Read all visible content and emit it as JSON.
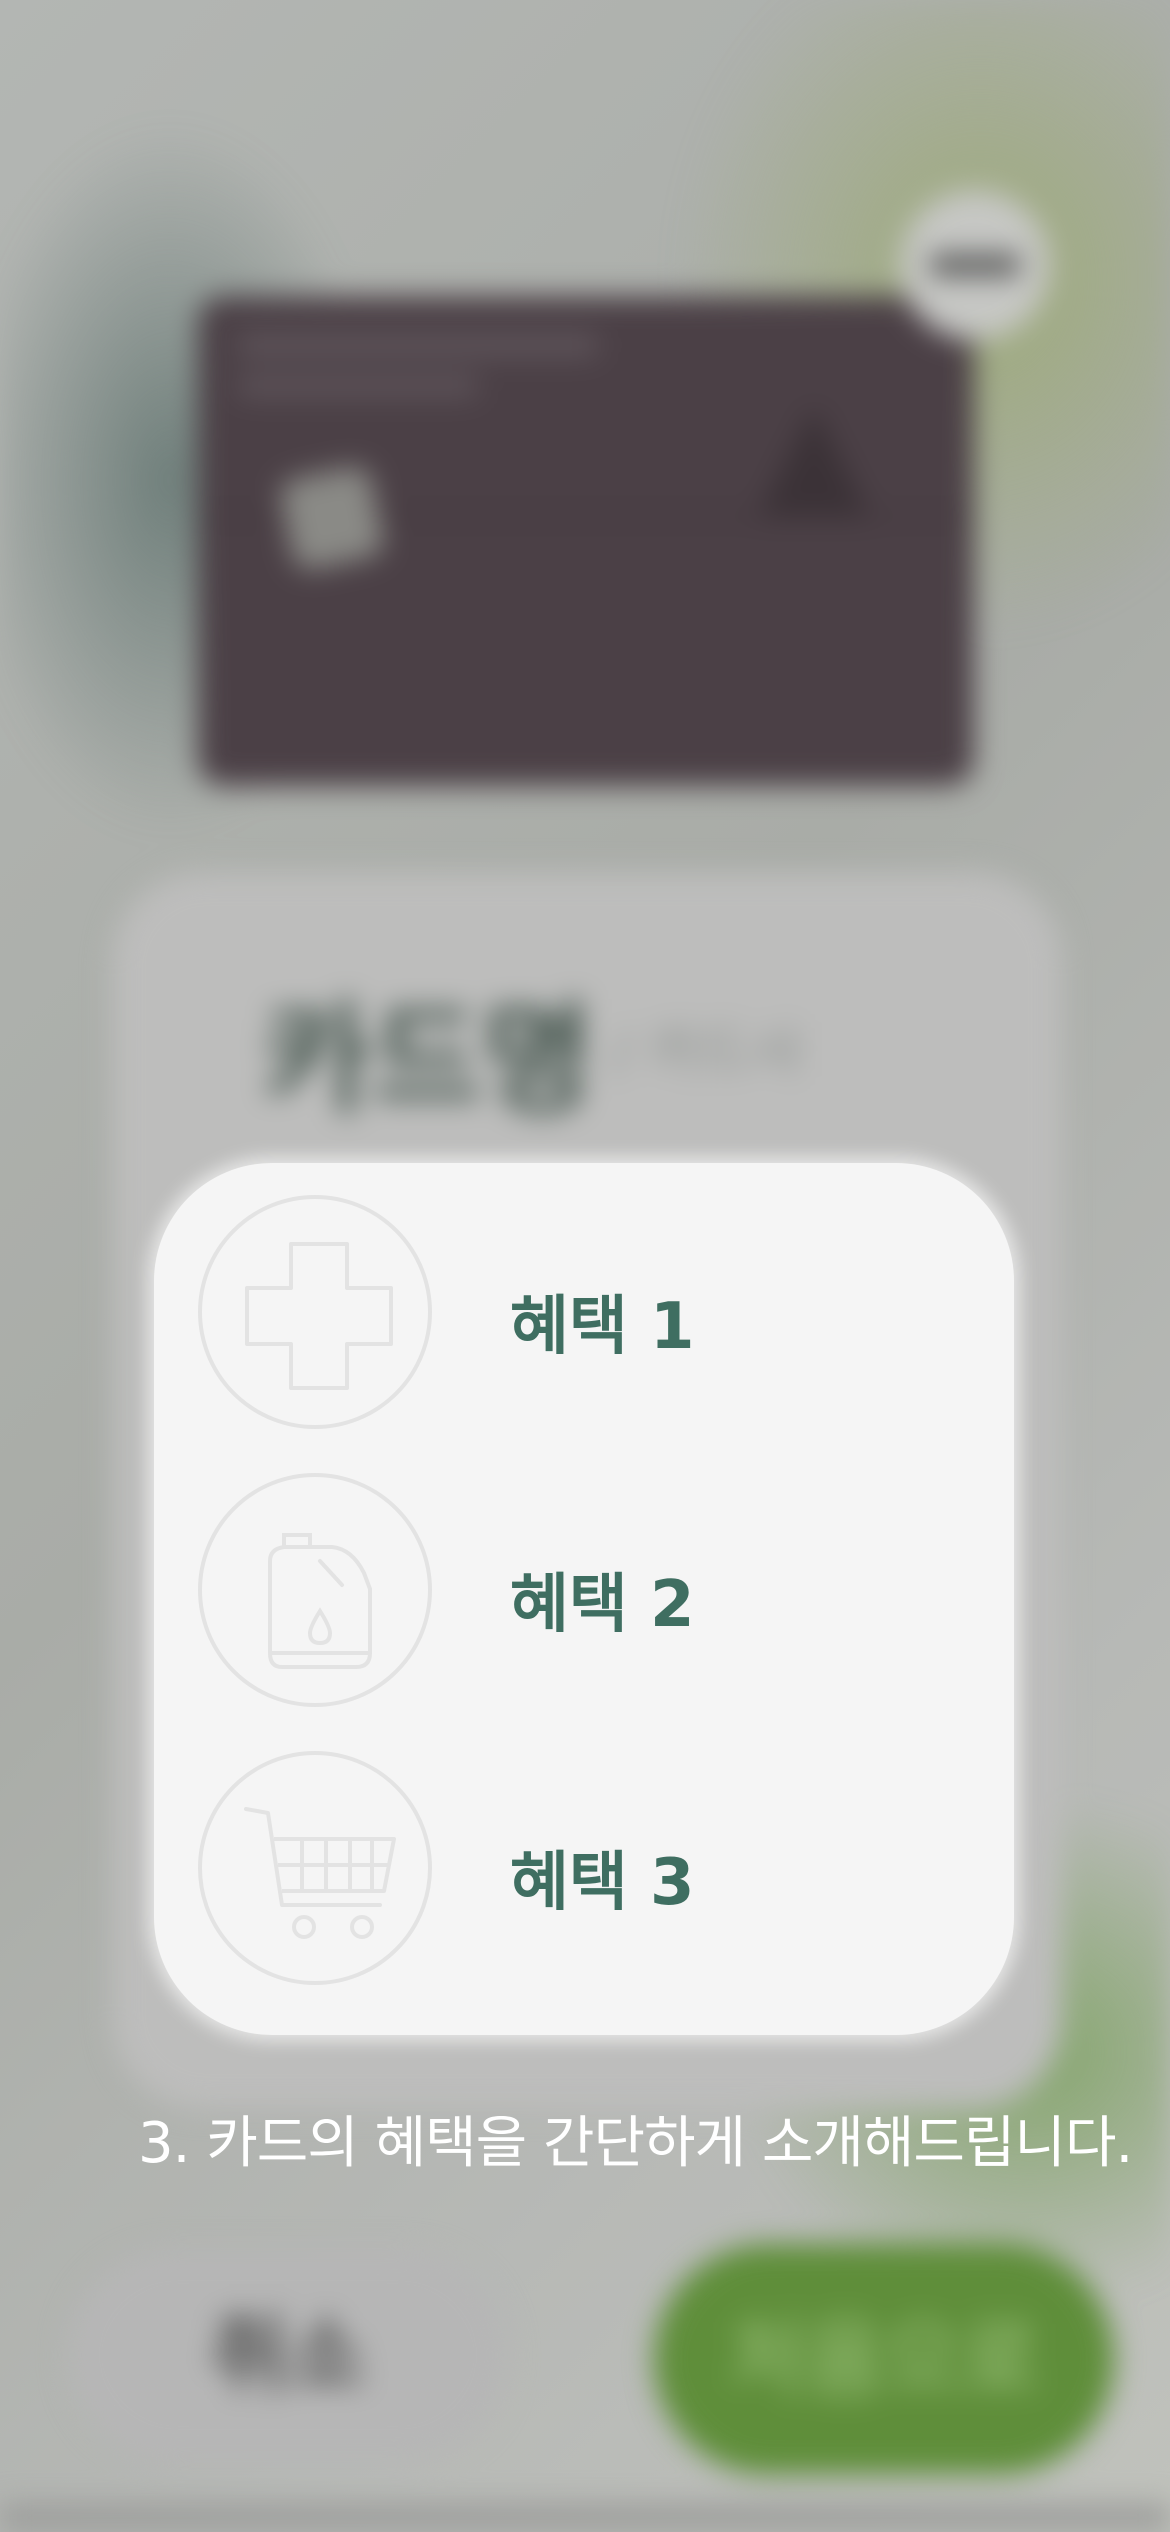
{
  "card": {
    "name": "카드명",
    "issuer": "/ 카드사"
  },
  "benefits": [
    {
      "label": "혜택 1",
      "icon": "medical-cross-icon"
    },
    {
      "label": "혜택 2",
      "icon": "fuel-canister-icon"
    },
    {
      "label": "혜택 3",
      "icon": "shopping-cart-icon"
    }
  ],
  "tutorial": {
    "message": "3.  카드의 혜택을 간단하게 소개해드립니다."
  },
  "buttons": {
    "cancel": "취소",
    "start": "처음으로"
  },
  "colors": {
    "benefit_text": "#3f6e61",
    "card_background": "#4b4046",
    "primary_button": "#5f8e3a",
    "highlight_box": "#f5f5f5"
  }
}
